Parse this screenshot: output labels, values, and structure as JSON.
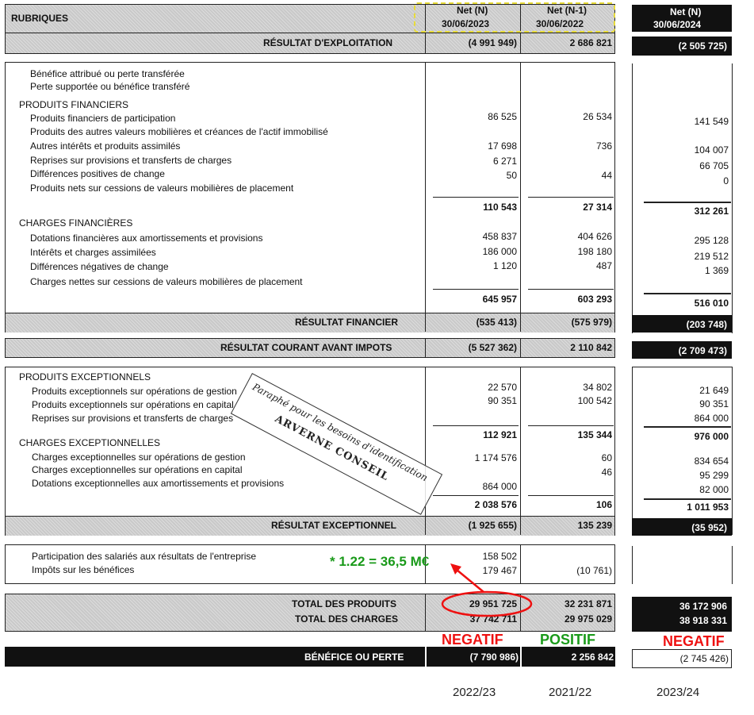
{
  "header": {
    "rubriques": "RUBRIQUES",
    "col_n_title": "Net (N)",
    "col_n_date": "30/06/2023",
    "col_n1_title": "Net (N-1)",
    "col_n1_date": "30/06/2022",
    "col3_title": "Net (N)",
    "col3_date": "30/06/2024"
  },
  "exploitation": {
    "label": "RÉSULTAT D'EXPLOITATION",
    "n": "(4 991 949)",
    "n1": "2 686 821",
    "n24": "(2 505 725)"
  },
  "financier": {
    "pre": [
      "Bénéfice attribué ou perte transférée",
      "Perte supportée ou bénéfice transféré"
    ],
    "produits_title": "PRODUITS FINANCIERS",
    "produits": [
      {
        "label": "Produits financiers de participation",
        "n": "86 525",
        "n1": "26 534",
        "n24": "141 549"
      },
      {
        "label": "Produits des autres valeurs mobilières et créances de l'actif immobilisé",
        "n": "",
        "n1": "",
        "n24": ""
      },
      {
        "label": "Autres intérêts et produits assimilés",
        "n": "17 698",
        "n1": "736",
        "n24": "104 007"
      },
      {
        "label": "Reprises sur provisions et transferts de charges",
        "n": "6 271",
        "n1": "",
        "n24": "66 705"
      },
      {
        "label": "Différences positives de change",
        "n": "50",
        "n1": "44",
        "n24": "0"
      },
      {
        "label": "Produits nets sur cessions de valeurs mobilières de placement",
        "n": "",
        "n1": "",
        "n24": ""
      }
    ],
    "produits_total": {
      "n": "110 543",
      "n1": "27 314",
      "n24": "312 261"
    },
    "charges_title": "CHARGES FINANCIÈRES",
    "charges": [
      {
        "label": "Dotations financières aux amortissements et provisions",
        "n": "458 837",
        "n1": "404 626",
        "n24": "295 128"
      },
      {
        "label": "Intérêts et charges assimilées",
        "n": "186 000",
        "n1": "198 180",
        "n24": "219 512"
      },
      {
        "label": "Différences négatives de change",
        "n": "1 120",
        "n1": "487",
        "n24": "1 369"
      },
      {
        "label": "Charges nettes sur cessions de valeurs mobilières de placement",
        "n": "",
        "n1": "",
        "n24": ""
      }
    ],
    "charges_total": {
      "n": "645 957",
      "n1": "603 293",
      "n24": "516 010"
    },
    "resultat": {
      "label": "RÉSULTAT FINANCIER",
      "n": "(535 413)",
      "n1": "(575 979)",
      "n24": "(203 748)"
    }
  },
  "courant": {
    "label": "RÉSULTAT COURANT AVANT IMPOTS",
    "n": "(5 527 362)",
    "n1": "2 110 842",
    "n24": "(2 709 473)"
  },
  "exceptionnel": {
    "produits_title": "PRODUITS EXCEPTIONNELS",
    "produits": [
      {
        "label": "Produits exceptionnels sur opérations de gestion",
        "n": "22 570",
        "n1": "34 802",
        "n24": "21 649"
      },
      {
        "label": "Produits exceptionnels sur opérations en capital",
        "n": "90 351",
        "n1": "100 542",
        "n24": "90 351"
      },
      {
        "label": "Reprises sur provisions et transferts de charges",
        "n": "",
        "n1": "",
        "n24": "864 000"
      }
    ],
    "produits_total": {
      "n": "112 921",
      "n1": "135 344",
      "n24": "976 000"
    },
    "charges_title": "CHARGES EXCEPTIONNELLES",
    "charges": [
      {
        "label": "Charges exceptionnelles sur opérations de gestion",
        "n": "1 174 576",
        "n1": "60",
        "n24": "834 654"
      },
      {
        "label": "Charges exceptionnelles sur opérations en capital",
        "n": "",
        "n1": "46",
        "n24": "95 299"
      },
      {
        "label": "Dotations exceptionnelles aux amortissements et provisions",
        "n": "864 000",
        "n1": "",
        "n24": "82 000"
      }
    ],
    "charges_total": {
      "n": "2 038 576",
      "n1": "106",
      "n24": "1 011 953"
    },
    "resultat": {
      "label": "RÉSULTAT EXCEPTIONNEL",
      "n": "(1 925 655)",
      "n1": "135 239",
      "n24": "(35 952)"
    }
  },
  "participation": {
    "rows": [
      {
        "label": "Participation des salariés aux résultats de l'entreprise",
        "n": "158 502",
        "n1": ""
      },
      {
        "label": "Impôts sur les bénéfices",
        "n": "179 467",
        "n1": "(10 761)"
      }
    ]
  },
  "totals": {
    "produits": {
      "label": "TOTAL DES PRODUITS",
      "n": "29 951 725",
      "n1": "32 231 871",
      "n24": "36 172 906"
    },
    "charges": {
      "label": "TOTAL DES CHARGES",
      "n": "37 742 711",
      "n1": "29 975 029",
      "n24": "38 918 331"
    }
  },
  "benefice": {
    "label": "BÉNÉFICE OU PERTE",
    "n": "(7 790 986)",
    "n1": "2 256 842",
    "n24": "(2 745 426)"
  },
  "annotations": {
    "multiplier": "* 1.22 = 36,5 M€",
    "negatif": "NEGATIF",
    "positif": "POSITIF",
    "year_n": "2022/23",
    "year_n1": "2021/22",
    "year_n24": "2023/24",
    "color_red": "#ee1111",
    "color_green": "#1a9a1a"
  },
  "stamp": {
    "line1": "Paraphé pour les besoins d'identification",
    "line2": "ARVERNE CONSEIL"
  }
}
